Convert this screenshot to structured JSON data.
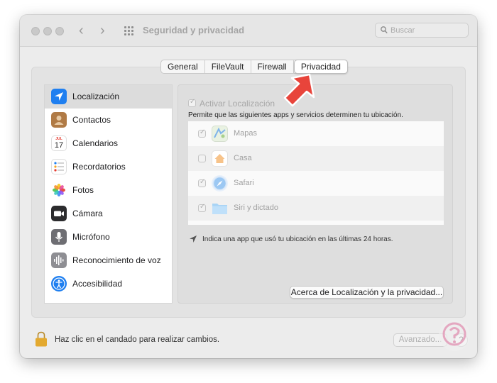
{
  "window": {
    "title": "Seguridad y privacidad"
  },
  "search": {
    "placeholder": "Buscar"
  },
  "tabs": [
    {
      "label": "General",
      "active": false
    },
    {
      "label": "FileVault",
      "active": false
    },
    {
      "label": "Firewall",
      "active": false
    },
    {
      "label": "Privacidad",
      "active": true
    }
  ],
  "sidebar": {
    "items": [
      {
        "label": "Localización",
        "icon": "location-arrow-icon",
        "selected": true
      },
      {
        "label": "Contactos",
        "icon": "contacts-icon",
        "selected": false
      },
      {
        "label": "Calendarios",
        "icon": "calendar-icon",
        "selected": false
      },
      {
        "label": "Recordatorios",
        "icon": "reminders-icon",
        "selected": false
      },
      {
        "label": "Fotos",
        "icon": "photos-icon",
        "selected": false
      },
      {
        "label": "Cámara",
        "icon": "camera-icon",
        "selected": false
      },
      {
        "label": "Micrófono",
        "icon": "microphone-icon",
        "selected": false
      },
      {
        "label": "Reconocimiento de voz",
        "icon": "speech-recognition-icon",
        "selected": false
      },
      {
        "label": "Accesibilidad",
        "icon": "accessibility-icon",
        "selected": false
      }
    ],
    "calendar_month": "JUL",
    "calendar_day": "17"
  },
  "location": {
    "enable_label": "Activar Localización",
    "enable_checked": true,
    "description": "Permite que las siguientes apps y servicios determinen tu ubicación.",
    "apps": [
      {
        "label": "Mapas",
        "checked": true,
        "icon": "maps-icon"
      },
      {
        "label": "Casa",
        "checked": false,
        "icon": "home-icon"
      },
      {
        "label": "Safari",
        "checked": true,
        "icon": "safari-icon"
      },
      {
        "label": "Siri y dictado",
        "checked": true,
        "icon": "folder-icon"
      }
    ],
    "hint": "Indica una app que usó tu ubicación en las últimas 24 horas.",
    "about_button": "Acerca de Localización y la privacidad..."
  },
  "footer": {
    "lock_text": "Haz clic en el candado para realizar cambios.",
    "advanced_button": "Avanzado...",
    "help_label": "?"
  },
  "colors": {
    "accent_blue": "#1f7ff0",
    "annotation_arrow": "#e8443b",
    "lock_gold": "#e3a92f"
  }
}
